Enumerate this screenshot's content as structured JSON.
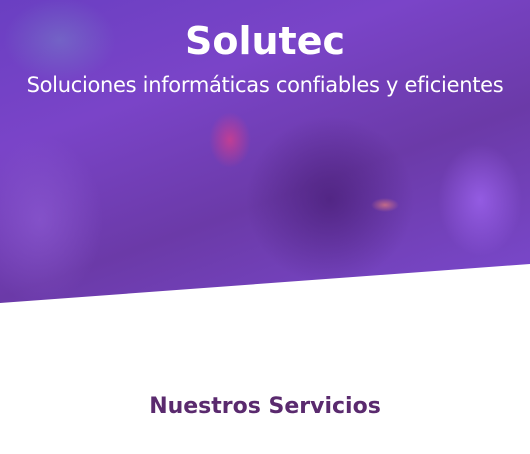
{
  "hero": {
    "title": "Solutec",
    "subtitle": "Soluciones informáticas confiables y eficientes"
  },
  "services": {
    "title": "Nuestros Servicios"
  },
  "colors": {
    "hero_overlay": "#6a3fc2",
    "section_title": "#5a2a6e"
  }
}
